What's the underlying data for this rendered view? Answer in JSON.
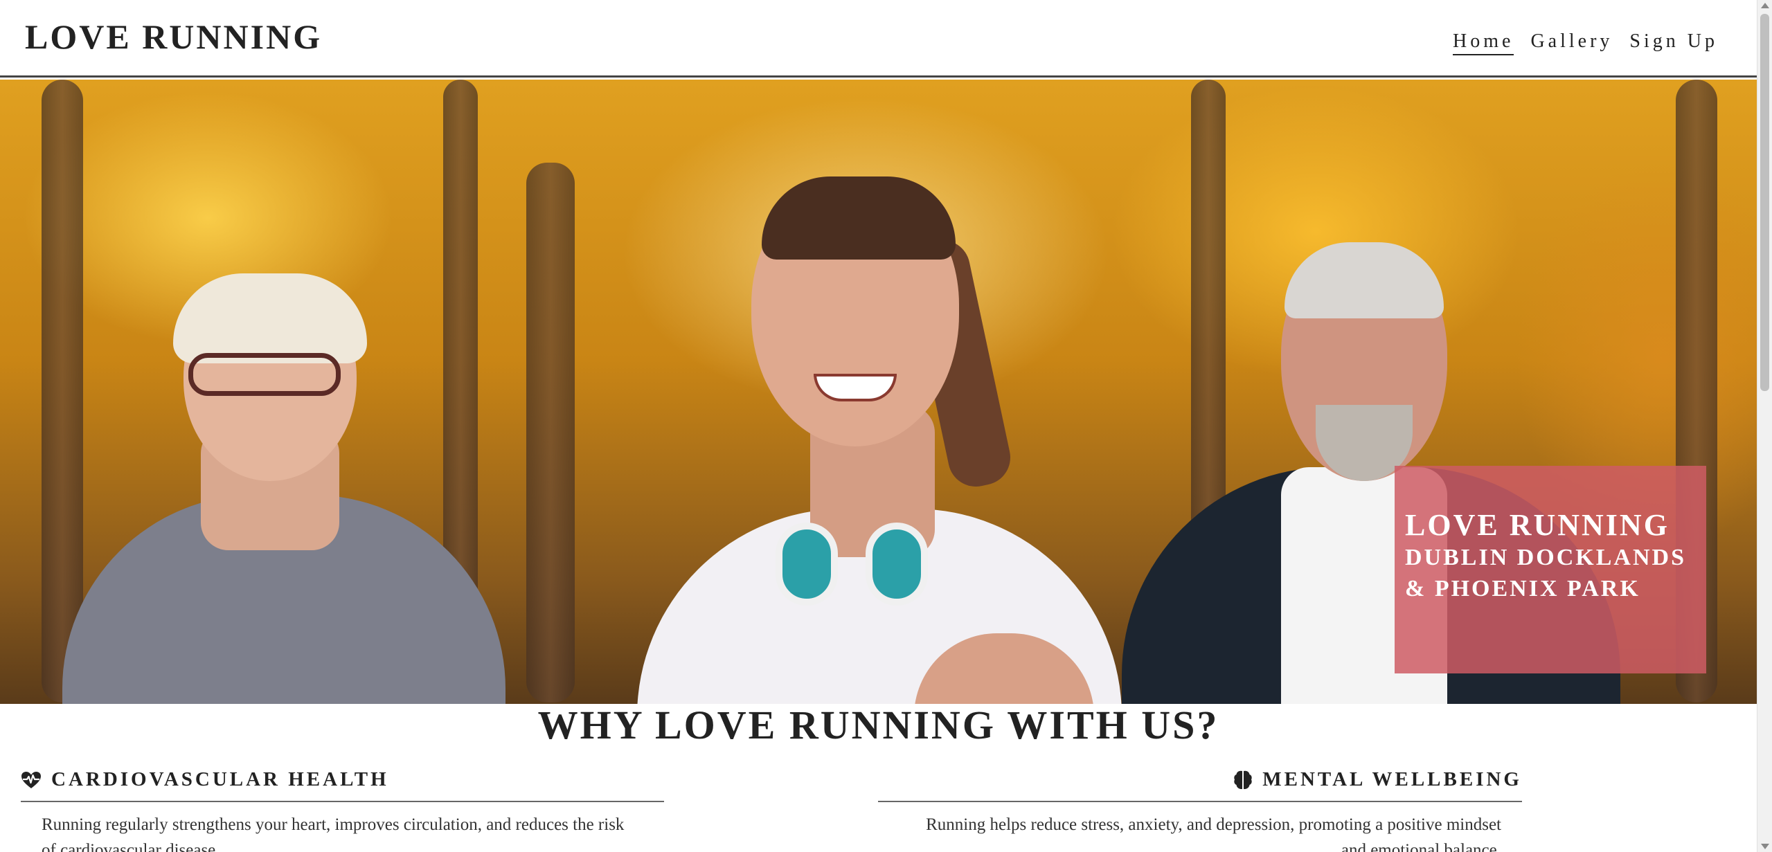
{
  "header": {
    "brand": "LOVE RUNNING",
    "nav": [
      {
        "label": "Home",
        "active": true
      },
      {
        "label": "Gallery",
        "active": false
      },
      {
        "label": "Sign Up",
        "active": false
      }
    ]
  },
  "hero": {
    "caption_title": "LOVE RUNNING",
    "caption_line1": "DUBLIN DOCKLANDS",
    "caption_line2": "& PHOENIX PARK",
    "caption_color": "#ce5c64"
  },
  "why": {
    "title": "WHY LOVE RUNNING WITH US?"
  },
  "features": [
    {
      "icon": "heart-pulse-icon",
      "title": "CARDIOVASCULAR HEALTH",
      "text": "Running regularly strengthens your heart, improves circulation, and reduces the risk of cardiovascular disease."
    },
    {
      "icon": "brain-icon",
      "title": "MENTAL WELLBEING",
      "text": "Running helps reduce stress, anxiety, and depression, promoting a positive mindset and emotional balance."
    }
  ]
}
